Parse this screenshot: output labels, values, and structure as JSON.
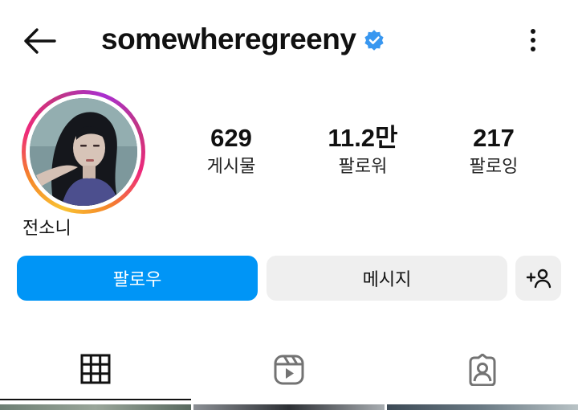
{
  "header": {
    "username": "somewheregreeny",
    "back_icon": "arrow-left-icon",
    "verified_icon": "verified-badge-icon",
    "more_icon": "more-vertical-icon"
  },
  "profile": {
    "display_name": "전소니",
    "avatar": "profile-photo",
    "stats": [
      {
        "value": "629",
        "label": "게시물"
      },
      {
        "value": "11.2만",
        "label": "팔로워"
      },
      {
        "value": "217",
        "label": "팔로잉"
      }
    ]
  },
  "actions": {
    "follow_label": "팔로우",
    "message_label": "메시지",
    "suggest_icon": "person-plus-icon"
  },
  "tabs": [
    {
      "icon": "grid-icon",
      "active": true
    },
    {
      "icon": "reels-icon",
      "active": false
    },
    {
      "icon": "tagged-icon",
      "active": false
    }
  ],
  "colors": {
    "accent": "#0095f6",
    "verified": "#3897f0",
    "secondary_button": "#efefef",
    "icon_gray": "#737373"
  }
}
